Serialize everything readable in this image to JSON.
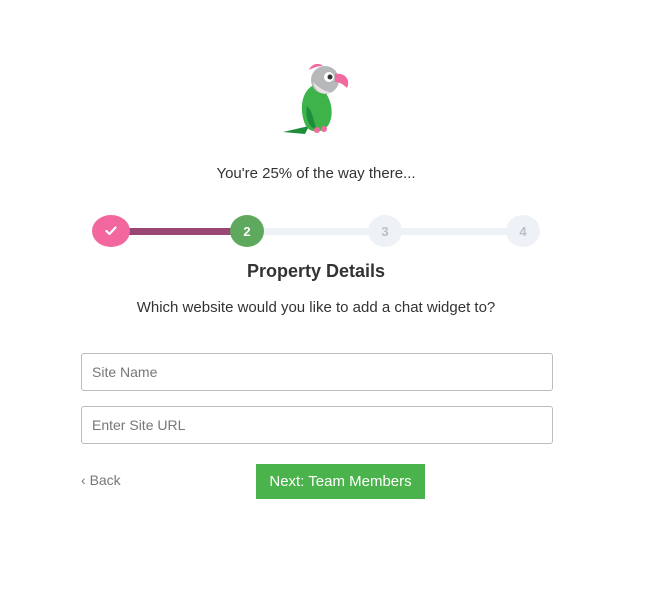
{
  "header": {
    "logo_icon": "parrot-logo-icon",
    "progress_text": "You're 25% of the way there...",
    "progress_fraction": 0.25
  },
  "stepper": {
    "steps": [
      {
        "label": "",
        "state": "complete",
        "icon": "check-icon"
      },
      {
        "label": "2",
        "state": "current"
      },
      {
        "label": "3",
        "state": "upcoming"
      },
      {
        "label": "4",
        "state": "upcoming"
      }
    ]
  },
  "main": {
    "title": "Property Details",
    "subtitle": "Which website would you like to add a chat widget to?",
    "site_name": {
      "value": "",
      "placeholder": "Site Name"
    },
    "site_url": {
      "value": "",
      "placeholder": "Enter Site URL"
    }
  },
  "actions": {
    "back_label": "Back",
    "back_icon": "chevron-left-icon",
    "next_label": "Next: Team Members"
  },
  "colors": {
    "complete_step": "#f2679d",
    "completed_track": "#9a4674",
    "current_step": "#5ea95e",
    "upcoming_step": "#eef2f6",
    "primary_button": "#4bb34b"
  }
}
